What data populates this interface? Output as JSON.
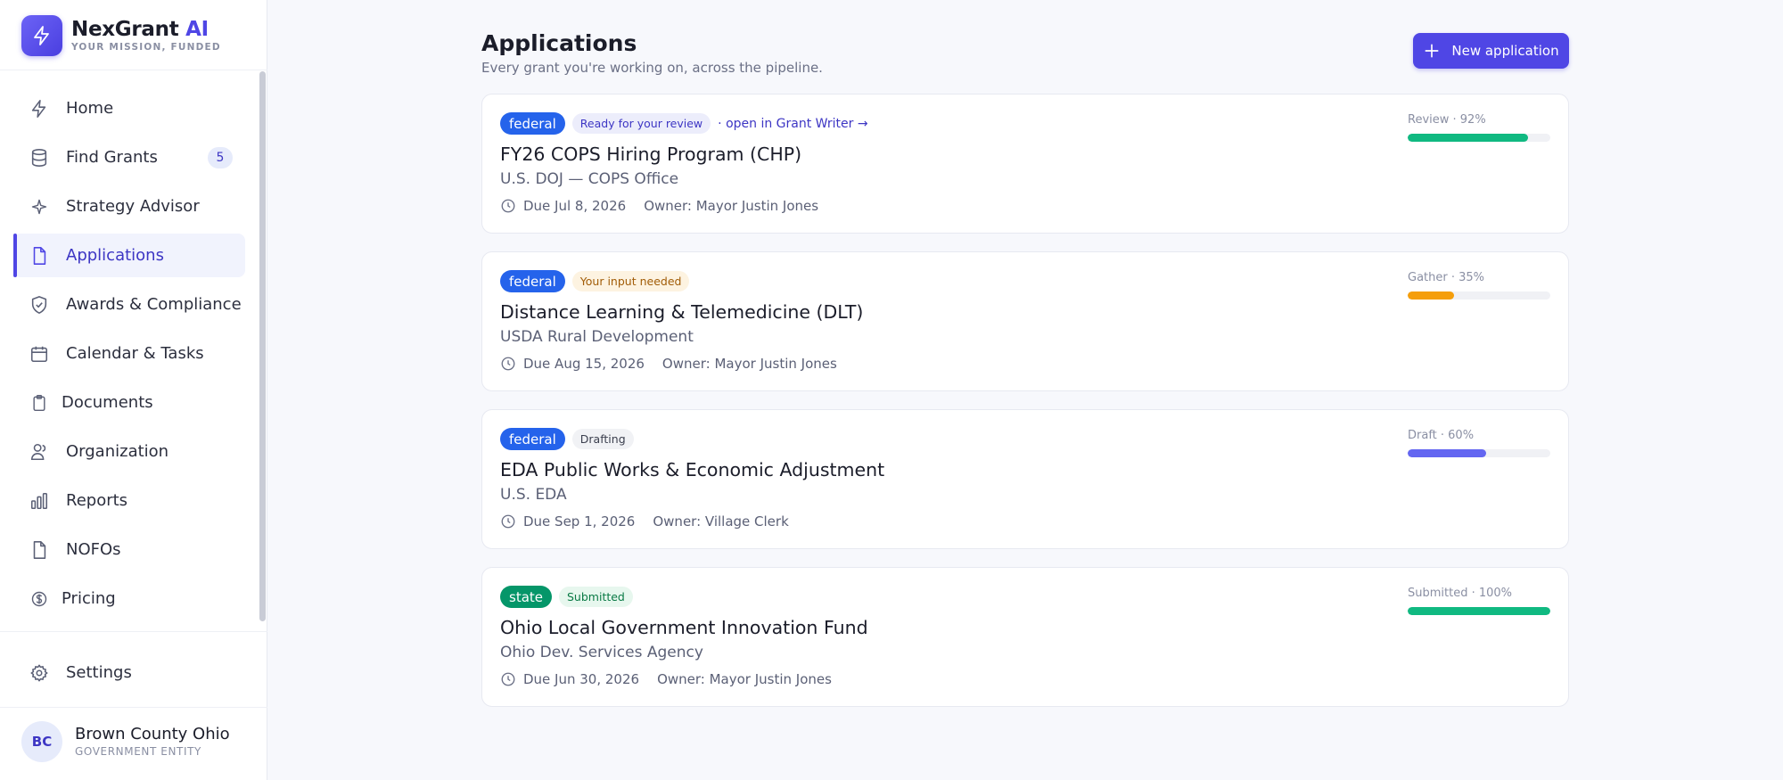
{
  "brand": {
    "name": "NexGrant",
    "name_accent": "AI",
    "tagline": "YOUR MISSION, FUNDED"
  },
  "nav": [
    {
      "label": "Home",
      "icon": "bolt-icon"
    },
    {
      "label": "Find Grants",
      "icon": "database-icon",
      "badge": "5"
    },
    {
      "label": "Strategy Advisor",
      "icon": "sparkle-icon"
    },
    {
      "label": "Applications",
      "icon": "document-icon",
      "active": true
    },
    {
      "label": "Awards & Compliance",
      "icon": "shield-check-icon"
    },
    {
      "label": "Calendar & Tasks",
      "icon": "calendar-icon"
    },
    {
      "label": "Documents",
      "icon": "clipboard-icon"
    },
    {
      "label": "Organization",
      "icon": "users-icon"
    },
    {
      "label": "Reports",
      "icon": "bar-chart-icon"
    },
    {
      "label": "NOFOs",
      "icon": "file-icon"
    },
    {
      "label": "Pricing",
      "icon": "dollar-circle-icon"
    }
  ],
  "settings": {
    "label": "Settings",
    "icon": "gear-icon"
  },
  "user": {
    "initials": "BC",
    "name": "Brown County Ohio",
    "role": "GOVERNMENT ENTITY"
  },
  "page": {
    "title": "Applications",
    "subtitle": "Every grant you're working on, across the pipeline.",
    "new_button": "New application"
  },
  "colors": {
    "accent": "#4f46e5",
    "federal": "#2563eb",
    "state": "#059669",
    "green": "#10b981",
    "amber": "#f59e0b",
    "indigo": "#6366f1"
  },
  "applications": [
    {
      "type": "federal",
      "status": "Ready for your review",
      "link": "· open in Grant Writer →",
      "title": "FY26 COPS Hiring Program (CHP)",
      "agency": "U.S. DOJ — COPS Office",
      "due": "Due Jul 8, 2026",
      "owner": "Owner: Mayor Justin Jones",
      "progress_label": "Review · 92%",
      "progress": 92,
      "progress_color": "#10b981"
    },
    {
      "type": "federal",
      "status": "Your input needed",
      "title": "Distance Learning & Telemedicine (DLT)",
      "agency": "USDA Rural Development",
      "due": "Due Aug 15, 2026",
      "owner": "Owner: Mayor Justin Jones",
      "progress_label": "Gather · 35%",
      "progress": 35,
      "progress_color": "#f59e0b"
    },
    {
      "type": "federal",
      "status": "Drafting",
      "title": "EDA Public Works & Economic Adjustment",
      "agency": "U.S. EDA",
      "due": "Due Sep 1, 2026",
      "owner": "Owner: Village Clerk",
      "progress_label": "Draft · 60%",
      "progress": 60,
      "progress_color": "#6366f1"
    },
    {
      "type": "state",
      "status": "Submitted",
      "title": "Ohio Local Government Innovation Fund",
      "agency": "Ohio Dev. Services Agency",
      "due": "Due Jun 30, 2026",
      "owner": "Owner: Mayor Justin Jones",
      "progress_label": "Submitted · 100%",
      "progress": 100,
      "progress_color": "#10b981"
    }
  ]
}
